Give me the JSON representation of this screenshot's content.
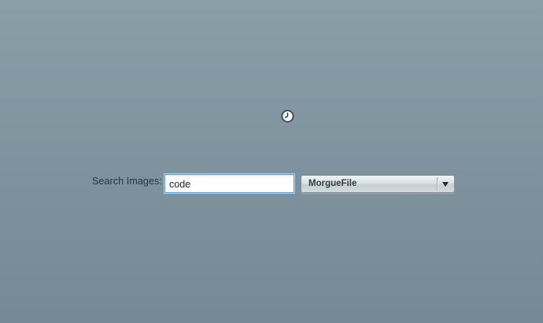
{
  "search": {
    "label": "Search Images:",
    "query": "code",
    "source_selected": "MorgueFile"
  },
  "icons": {
    "loading": "clock-spinner-icon",
    "dropdown": "chevron-down-icon"
  },
  "colors": {
    "background_top": "#8a9ea8",
    "background_bottom": "#748a95",
    "label_text": "#1f3a44",
    "input_focus_border": "#5a9fd0"
  }
}
